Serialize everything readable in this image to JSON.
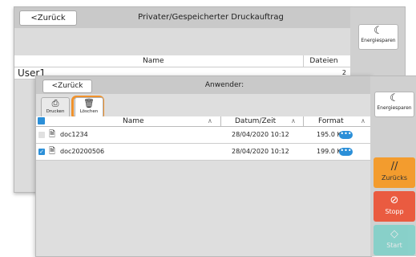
{
  "back_dialog": {
    "back_label": "<Zurück",
    "title": "Privater/Gespeicherter Druckauftrag",
    "col_name": "Name",
    "col_files": "Dateien",
    "rows": [
      {
        "user": "User1",
        "count": "2"
      }
    ]
  },
  "eco": {
    "label": "Energiesparen",
    "icon": "moon-icon"
  },
  "front_dialog": {
    "back_label": "<Zurück",
    "title": "Anwender:",
    "toolbar": {
      "print_label": "Drucken",
      "print_icon": "printer-icon",
      "delete_label": "Löschen",
      "delete_icon": "trash-icon"
    },
    "columns": {
      "name": "Name",
      "date": "Datum/Zeit",
      "format": "Format"
    },
    "rows": [
      {
        "name": "doc1234",
        "date": "28/04/2020 10:12",
        "size": "195.0 KB",
        "checked": false
      },
      {
        "name": "doc20200506",
        "date": "28/04/2020 10:12",
        "size": "199.0 KB",
        "checked": true
      }
    ]
  },
  "side_buttons": {
    "back": {
      "label": "Zurücks",
      "color": "#f39c2e"
    },
    "stop": {
      "label": "Stopp",
      "color": "#ea5b40"
    },
    "start": {
      "label": "Start",
      "color": "#4fd1c5"
    }
  },
  "colors": {
    "accent": "#2b8fd8",
    "highlight": "#f0922c"
  }
}
